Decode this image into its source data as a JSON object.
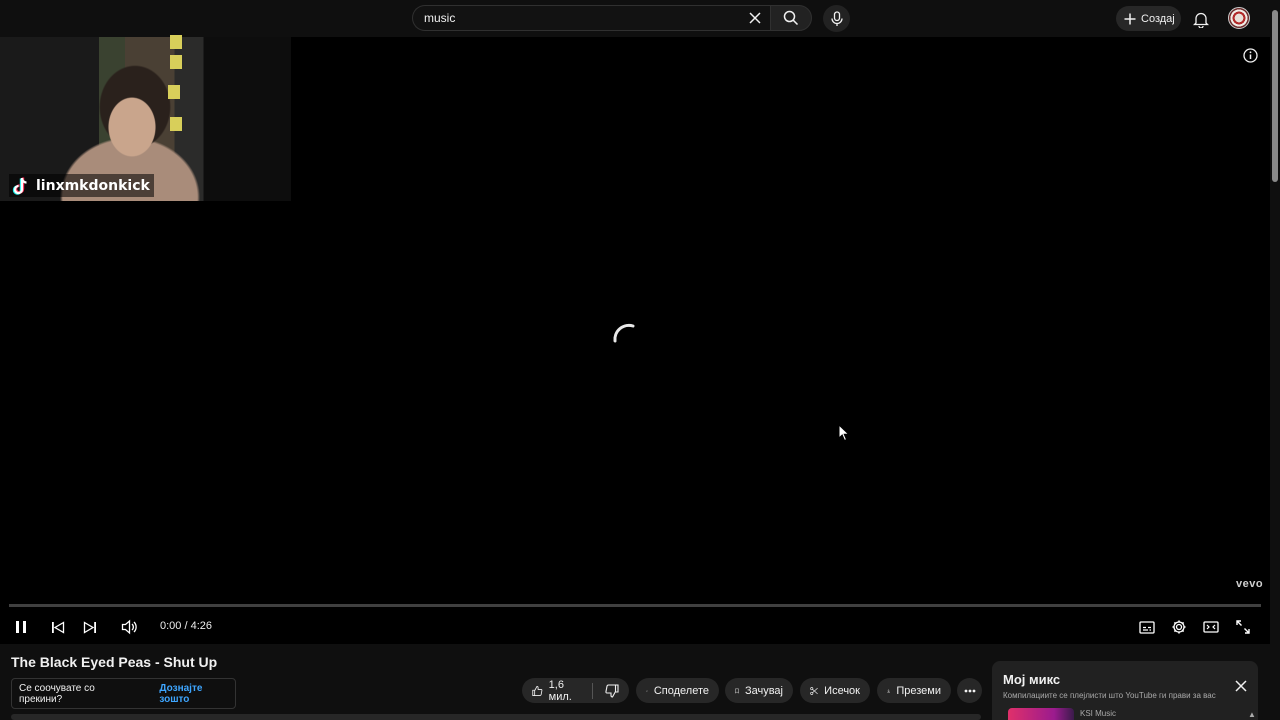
{
  "search": {
    "query": "music"
  },
  "header": {
    "create_label": "Создај"
  },
  "webcam": {
    "username": "linxmkdonkick"
  },
  "player": {
    "watermark": "vevo",
    "time_current": "0:00",
    "time_separator": "/",
    "time_total": "4:26",
    "progress": 0,
    "state": "loading"
  },
  "video": {
    "title": "The Black Eyed Peas - Shut Up"
  },
  "actions": {
    "like_count": "1,6 мил.",
    "share_label": "Споделете",
    "save_label": "Зачувај",
    "clip_label": "Исечок",
    "download_label": "Преземи"
  },
  "toast": {
    "message": "Се соочувате со прекини?",
    "link": "Дознајте зошто"
  },
  "mix": {
    "title": "Мој микс",
    "subtitle": "Компилациите се плејлисти што YouTube ги прави за вас",
    "channel": "KSI Music"
  },
  "colors": {
    "background": "#0f0f0f",
    "player": "#000000",
    "link": "#3ea6ff",
    "pill": "#272727"
  },
  "icons": [
    "clear-icon",
    "search-icon",
    "mic-icon",
    "plus-icon",
    "bell-icon",
    "info-icon",
    "pause-icon",
    "previous-icon",
    "next-icon",
    "volume-icon",
    "subtitles-icon",
    "settings-icon",
    "theater-icon",
    "fullscreen-icon",
    "like-icon",
    "dislike-icon",
    "share-icon",
    "save-icon",
    "clip-icon",
    "download-icon",
    "more-icon",
    "close-icon",
    "tiktok-icon"
  ]
}
